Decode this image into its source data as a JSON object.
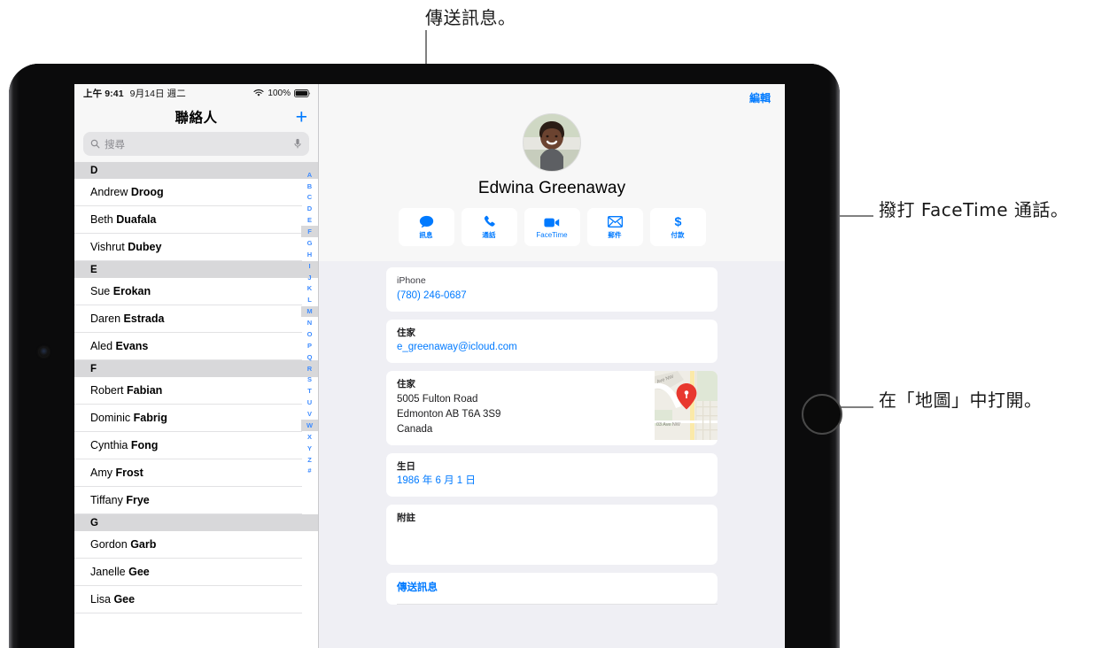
{
  "statusbar": {
    "time": "上午 9:41",
    "date": "9月14日 週二",
    "battery": "100%",
    "wifi_icon": "wifi-icon",
    "battery_icon": "battery-icon"
  },
  "sidebar": {
    "title": "聯絡人",
    "add_label": "+",
    "search": {
      "placeholder": "搜尋",
      "search_icon": "search-icon",
      "mic_icon": "microphone-icon"
    },
    "sections": [
      {
        "letter": "D",
        "contacts": [
          {
            "first": "Andrew",
            "last": "Droog"
          },
          {
            "first": "Beth",
            "last": "Duafala"
          },
          {
            "first": "Vishrut",
            "last": "Dubey"
          }
        ]
      },
      {
        "letter": "E",
        "contacts": [
          {
            "first": "Sue",
            "last": "Erokan"
          },
          {
            "first": "Daren",
            "last": "Estrada"
          },
          {
            "first": "Aled",
            "last": "Evans"
          }
        ]
      },
      {
        "letter": "F",
        "contacts": [
          {
            "first": "Robert",
            "last": "Fabian"
          },
          {
            "first": "Dominic",
            "last": "Fabrig"
          },
          {
            "first": "Cynthia",
            "last": "Fong"
          },
          {
            "first": "Amy",
            "last": "Frost"
          },
          {
            "first": "Tiffany",
            "last": "Frye"
          }
        ]
      },
      {
        "letter": "G",
        "contacts": [
          {
            "first": "Gordon",
            "last": "Garb"
          },
          {
            "first": "Janelle",
            "last": "Gee"
          },
          {
            "first": "Lisa",
            "last": "Gee"
          }
        ]
      }
    ],
    "index": [
      "A",
      "B",
      "C",
      "D",
      "E",
      "F",
      "G",
      "H",
      "I",
      "J",
      "K",
      "L",
      "M",
      "N",
      "O",
      "P",
      "Q",
      "R",
      "S",
      "T",
      "U",
      "V",
      "W",
      "X",
      "Y",
      "Z",
      "#"
    ],
    "index_highlighted": [
      "F",
      "M",
      "W"
    ]
  },
  "detail": {
    "edit_label": "編輯",
    "name": "Edwina Greenaway",
    "avatar_name": "contact-photo",
    "actions": [
      {
        "label": "訊息",
        "icon": "message-bubble-icon",
        "latin": false
      },
      {
        "label": "通話",
        "icon": "phone-icon",
        "latin": false
      },
      {
        "label": "FaceTime",
        "icon": "video-camera-icon",
        "latin": true
      },
      {
        "label": "郵件",
        "icon": "envelope-icon",
        "latin": false
      },
      {
        "label": "付款",
        "icon": "dollar-sign-icon",
        "latin": false
      }
    ],
    "fields": {
      "phone": {
        "label": "iPhone",
        "value": "(780) 246-0687"
      },
      "email": {
        "label": "住家",
        "value": "e_greenaway@icloud.com"
      },
      "address": {
        "label": "住家",
        "lines": [
          "5005 Fulton Road",
          "Edmonton AB T6A 3S9",
          "Canada"
        ],
        "map_icon": "map-pin-icon",
        "map_streets": [
          "Ave NW",
          "03 Ave NW"
        ]
      },
      "birthday": {
        "label": "生日",
        "value": "1986 年 6 月 1 日"
      },
      "notes": {
        "label": "附註",
        "value": ""
      },
      "send_message": {
        "label": "傳送訊息"
      }
    }
  },
  "callouts": [
    {
      "text": "傳送訊息。",
      "target": "message-button"
    },
    {
      "text": "撥打 FaceTime 通話。",
      "target": "facetime-button"
    },
    {
      "text": "在「地圖」中打開。",
      "target": "address-map"
    }
  ],
  "colors": {
    "accent": "#007aff",
    "screen_bg": "#efeff4",
    "leader": "#808080"
  }
}
